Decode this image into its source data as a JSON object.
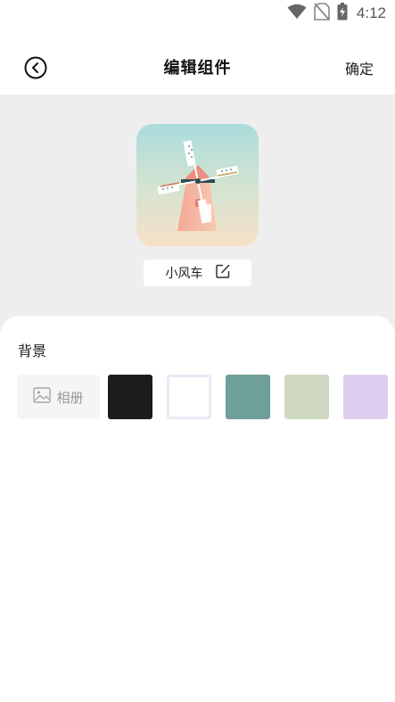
{
  "status_bar": {
    "time": "4:12",
    "icons": [
      "wifi-icon",
      "no-sim-icon",
      "battery-charging-icon"
    ]
  },
  "header": {
    "title": "编辑组件",
    "confirm_label": "确定",
    "back_icon": "back-circle-icon"
  },
  "preview": {
    "widget_name": "小风车",
    "edit_icon": "edit-icon",
    "widget_image": "windmill-illustration"
  },
  "background_section": {
    "label": "背景",
    "album_label": "相册",
    "album_icon": "image-icon",
    "swatches": [
      {
        "name": "black",
        "color": "#1c1c1c"
      },
      {
        "name": "white",
        "color": "#ffffff"
      },
      {
        "name": "teal",
        "color": "#6e9f98"
      },
      {
        "name": "sage",
        "color": "#cfd9c3"
      },
      {
        "name": "lavender",
        "color": "#dfcdef"
      }
    ]
  }
}
